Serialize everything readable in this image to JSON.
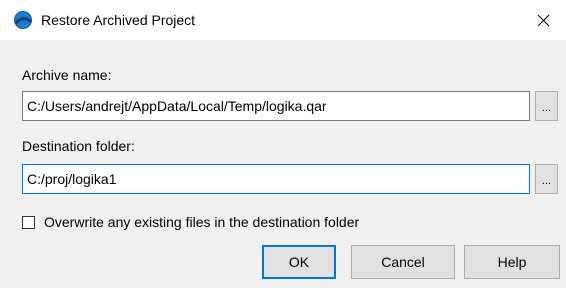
{
  "window": {
    "title": "Restore Archived Project",
    "close_glyph": "✕"
  },
  "archive": {
    "label": "Archive name:",
    "value": "C:/Users/andrejt/AppData/Local/Temp/logika.qar",
    "browse_label": "..."
  },
  "destination": {
    "label": "Destination folder:",
    "value": "C:/proj/logika1",
    "browse_label": "..."
  },
  "overwrite": {
    "label": "Overwrite any existing files in the destination folder",
    "checked": false
  },
  "buttons": {
    "ok": "OK",
    "cancel": "Cancel",
    "help": "Help"
  },
  "colors": {
    "accent": "#0078d7",
    "icon_primary": "#1a7fd0",
    "icon_secondary": "#0a3e78"
  }
}
